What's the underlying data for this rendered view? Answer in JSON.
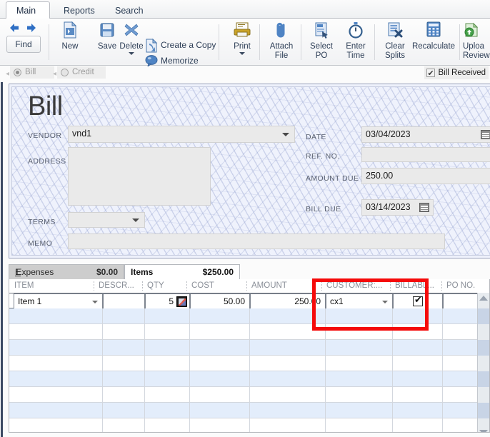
{
  "window": {
    "tabs": [
      {
        "label": "Main",
        "active": true
      },
      {
        "label": "Reports",
        "active": false
      },
      {
        "label": "Search",
        "active": false
      }
    ]
  },
  "toolbar": {
    "find_label": "Find",
    "back_icon": "arrow-left-icon",
    "forward_icon": "arrow-right-icon",
    "items": [
      {
        "label": "New",
        "icon": "new-document-icon"
      },
      {
        "label": "Save",
        "icon": "save-disk-icon"
      },
      {
        "label": "Delete",
        "icon": "delete-x-icon"
      },
      {
        "label": "Print",
        "icon": "printer-icon"
      },
      {
        "label": "Attach\nFile",
        "line1": "Attach",
        "line2": "File",
        "icon": "paperclip-icon"
      },
      {
        "label": "Select\nPO",
        "line1": "Select",
        "line2": "PO",
        "icon": "select-po-icon"
      },
      {
        "label": "Enter\nTime",
        "line1": "Enter",
        "line2": "Time",
        "icon": "stopwatch-icon"
      },
      {
        "label": "Clear\nSplits",
        "line1": "Clear",
        "line2": "Splits",
        "icon": "clear-splits-icon"
      },
      {
        "label": "Recalculate",
        "icon": "calculator-icon"
      },
      {
        "label": "Upload\nReview",
        "line1": "Uploa",
        "line2": "Review",
        "icon": "upload-icon"
      }
    ],
    "create_copy_label": "Create a Copy",
    "memorize_label": "Memorize",
    "create_copy_icon": "copy-document-icon",
    "memorize_icon": "memorize-balloon-icon"
  },
  "transaction_type": {
    "bill_label": "Bill",
    "credit_label": "Credit",
    "selected": "Bill",
    "bill_received_label": "Bill Received",
    "bill_received_checked": true
  },
  "document": {
    "heading": "Bill",
    "vendor_label": "VENDOR",
    "vendor_value": "vnd1",
    "address_label": "ADDRESS",
    "address_value": "",
    "terms_label": "TERMS",
    "terms_value": "",
    "memo_label": "MEMO",
    "memo_value": "",
    "date_label": "DATE",
    "date_value": "03/04/2023",
    "ref_no_label": "REF. NO.",
    "ref_no_value": "",
    "amount_due_label": "AMOUNT DUE",
    "amount_due_value": "250.00",
    "bill_due_label": "BILL DUE",
    "bill_due_value": "03/14/2023",
    "calendar_icon": "calendar-icon",
    "dropdown_icon": "chevron-down-icon"
  },
  "sheet_tabs": [
    {
      "label": "Expenses",
      "amount": "$0.00",
      "active": false
    },
    {
      "label": "Items",
      "amount": "$250.00",
      "active": true
    }
  ],
  "grid": {
    "columns": [
      "ITEM",
      "DESCR...",
      "QTY",
      "COST",
      "AMOUNT",
      "CUSTOMER:...",
      "BILLABL...",
      "PO NO."
    ],
    "rows": [
      {
        "item": "Item 1",
        "description": "",
        "qty": "5",
        "cost": "50.00",
        "amount": "250.00",
        "customer": "cx1",
        "billable_checked": true,
        "po_no": ""
      }
    ],
    "qty_icon": "image-cursor-icon",
    "empty_row_count": 8
  },
  "annotation": {
    "highlight_color": "#f50a0a",
    "target": "customer-and-billable-columns"
  }
}
